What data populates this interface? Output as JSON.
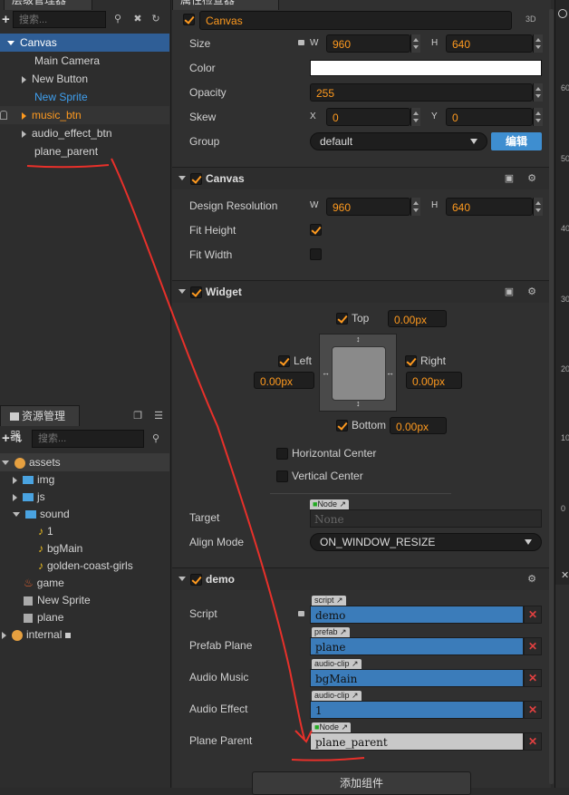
{
  "hierarchy": {
    "tab_label": "层级管理器",
    "search_placeholder": "搜索...",
    "items": [
      {
        "label": "Canvas"
      },
      {
        "label": "Main Camera"
      },
      {
        "label": "New Button"
      },
      {
        "label": "New Sprite"
      },
      {
        "label": "music_btn"
      },
      {
        "label": "audio_effect_btn"
      },
      {
        "label": "plane_parent"
      }
    ]
  },
  "assets": {
    "tab_label": "资源管理器",
    "search_placeholder": "搜索...",
    "items": [
      {
        "label": "assets"
      },
      {
        "label": "img"
      },
      {
        "label": "js"
      },
      {
        "label": "sound"
      },
      {
        "label": "1"
      },
      {
        "label": "bgMain"
      },
      {
        "label": "golden-coast-girls"
      },
      {
        "label": "game"
      },
      {
        "label": "New Sprite"
      },
      {
        "label": "plane"
      },
      {
        "label": "internal"
      }
    ]
  },
  "inspector": {
    "tab_label": "属性检查器",
    "node_name": "Canvas",
    "mode_badge": "3D",
    "node_props": {
      "size_label": "Size",
      "w": "W",
      "h": "H",
      "width": "960",
      "height": "640",
      "color_label": "Color",
      "opacity_label": "Opacity",
      "opacity": "255",
      "skew_label": "Skew",
      "skew_x_label": "X",
      "skew_y_label": "Y",
      "skew_x": "0",
      "skew_y": "0",
      "group_label": "Group",
      "group_value": "default",
      "edit_button": "编辑"
    },
    "canvas": {
      "title": "Canvas",
      "design_res_label": "Design Resolution",
      "w": "W",
      "h": "H",
      "width": "960",
      "height": "640",
      "fit_height_label": "Fit Height",
      "fit_width_label": "Fit Width"
    },
    "widget": {
      "title": "Widget",
      "top_label": "Top",
      "top_value": "0.00px",
      "left_label": "Left",
      "left_value": "0.00px",
      "right_label": "Right",
      "right_value": "0.00px",
      "bottom_label": "Bottom",
      "bottom_value": "0.00px",
      "hcenter_label": "Horizontal Center",
      "vcenter_label": "Vertical Center",
      "target_label": "Target",
      "target_tag": "Node",
      "target_value": "None",
      "align_mode_label": "Align Mode",
      "align_mode_value": "ON_WINDOW_RESIZE"
    },
    "demo": {
      "title": "demo",
      "script_label": "Script",
      "script_tag": "script",
      "script_value": "demo",
      "prefab_label": "Prefab Plane",
      "prefab_tag": "prefab",
      "prefab_value": "plane",
      "music_label": "Audio Music",
      "music_tag": "audio-clip",
      "music_value": "bgMain",
      "effect_label": "Audio Effect",
      "effect_tag": "audio-clip",
      "effect_value": "1",
      "parent_label": "Plane Parent",
      "parent_tag": "Node",
      "parent_value": "plane_parent"
    },
    "add_component_button": "添加组件"
  },
  "right_ruler": {
    "labels": [
      "60",
      "50",
      "40",
      "30",
      "20",
      "10",
      "0"
    ]
  },
  "colors": {
    "accent": "#ff9a1f",
    "selection": "#2f5e96",
    "asset_field": "#3b7cba",
    "annotation": "#e8302a"
  }
}
